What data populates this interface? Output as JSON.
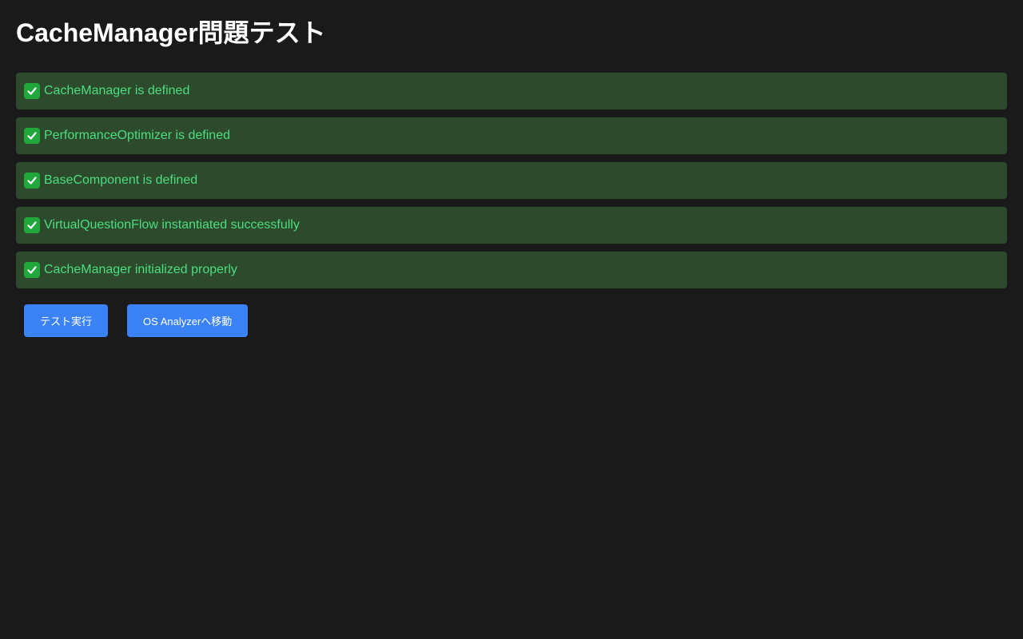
{
  "title": "CacheManager問題テスト",
  "results": [
    {
      "icon": "check-mark-icon",
      "text": "CacheManager is defined"
    },
    {
      "icon": "check-mark-icon",
      "text": "PerformanceOptimizer is defined"
    },
    {
      "icon": "check-mark-icon",
      "text": "BaseComponent is defined"
    },
    {
      "icon": "check-mark-icon",
      "text": "VirtualQuestionFlow instantiated successfully"
    },
    {
      "icon": "check-mark-icon",
      "text": "CacheManager initialized properly"
    }
  ],
  "buttons": {
    "run_test_label": "テスト実行",
    "os_analyzer_label": "OS Analyzerへ移動"
  },
  "colors": {
    "background": "#1a1a1a",
    "success_bg": "#2d4a2d",
    "success_text": "#4ade80",
    "button_bg": "#3b82f6"
  }
}
